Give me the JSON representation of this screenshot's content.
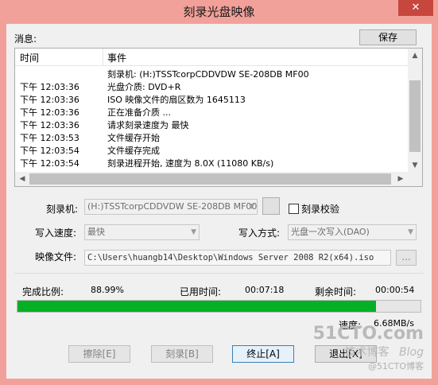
{
  "window": {
    "title": "刻录光盘映像",
    "close_glyph": "✕"
  },
  "messages": {
    "label": "消息:",
    "save_label": "保存",
    "columns": [
      "时间",
      "事件"
    ],
    "rows": [
      {
        "time": "",
        "event": "刻录机: (H:)TSSTcorpCDDVDW SE-208DB MF00"
      },
      {
        "time": "下午 12:03:36",
        "event": "光盘介质: DVD+R"
      },
      {
        "time": "下午 12:03:36",
        "event": "ISO 映像文件的扇区数为 1645113"
      },
      {
        "time": "下午 12:03:36",
        "event": "正在准备介质 ..."
      },
      {
        "time": "下午 12:03:36",
        "event": "请求刻录速度为 最快"
      },
      {
        "time": "下午 12:03:53",
        "event": "文件缓存开始"
      },
      {
        "time": "下午 12:03:54",
        "event": "文件缓存完成"
      },
      {
        "time": "下午 12:03:54",
        "event": "刻录进程开始, 速度为 8.0X (11080 KB/s)"
      }
    ]
  },
  "settings": {
    "burner_label": "刻录机:",
    "burner_value": "(H:)TSSTcorpCDDVDW SE-208DB MF00",
    "verify_label": "刻录校验",
    "verify_checked": false,
    "speed_label": "写入速度:",
    "speed_value": "最快",
    "mode_label": "写入方式:",
    "mode_value": "光盘一次写入(DAO)",
    "image_label": "映像文件:",
    "image_value": "C:\\Users\\huangb14\\Desktop\\Windows Server 2008 R2(x64).iso",
    "browse_label": "..."
  },
  "progress": {
    "complete_label": "完成比例:",
    "complete_value": "88.99%",
    "complete_fraction": 0.8899,
    "elapsed_label": "已用时间:",
    "elapsed_value": "00:07:18",
    "remaining_label": "剩余时间:",
    "remaining_value": "00:00:54",
    "speed_label": "速度:",
    "speed_value": "6.68MB/s",
    "bar_color": "#06b025"
  },
  "buttons": {
    "erase": "擦除[E]",
    "burn": "刻录[B]",
    "stop": "终止[A]",
    "exit": "退出[X]"
  },
  "watermark": {
    "site": "51CTO.com",
    "line2": "技术博客",
    "blog": "Blog",
    "credit": "@51CTO博客"
  }
}
